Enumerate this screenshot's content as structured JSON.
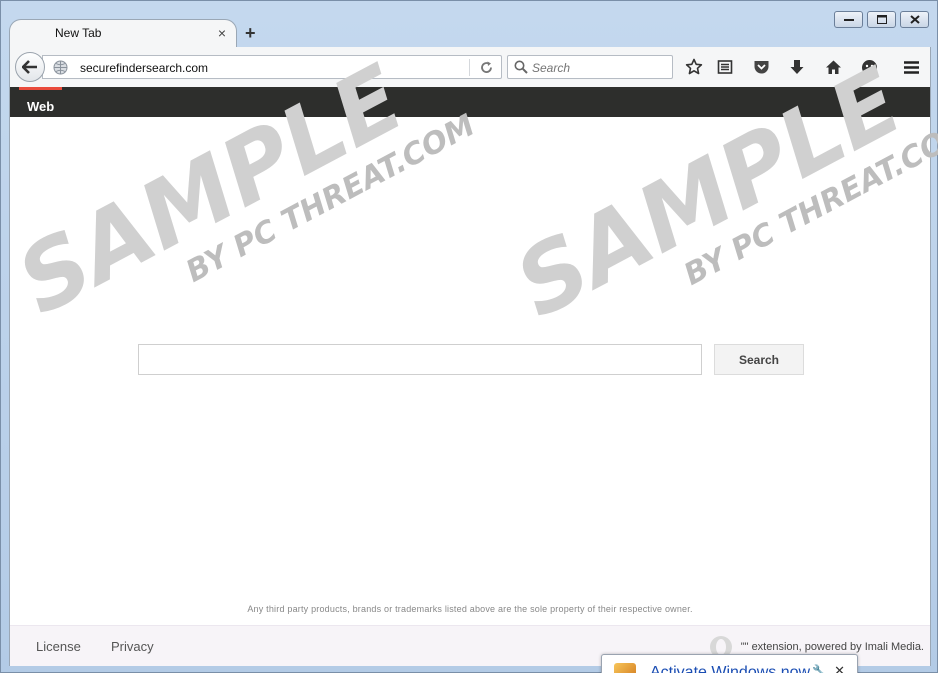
{
  "window": {
    "controls": [
      "minimize-icon",
      "restore-icon",
      "close-icon"
    ]
  },
  "tab": {
    "title": "New Tab",
    "close_glyph": "×",
    "new_tab_glyph": "+"
  },
  "toolbar": {
    "url": "securefindersearch.com",
    "search_placeholder": "Search",
    "icons": [
      "back-arrow-icon",
      "globe-icon",
      "reload-icon",
      "search-icon",
      "bookmark-star-icon",
      "reading-list-icon",
      "pocket-icon",
      "download-icon",
      "home-icon",
      "smiley-icon",
      "menu-icon"
    ]
  },
  "page": {
    "nav_tab": "Web",
    "search_button": "Search",
    "disclaimer": "Any third party products, brands or trademarks listed above are the sole property of their respective owner.",
    "footer": {
      "license": "License",
      "privacy": "Privacy",
      "powered_by": "\"\" extension, powered by Imali Media."
    }
  },
  "watermark": {
    "main": "SAMPLE",
    "sub": "BY PC THREAT.COM"
  },
  "popup": {
    "text": "Activate Windows now",
    "close_glyph": "✕",
    "tool_glyph": "🔧"
  },
  "colors": {
    "nav_bar": "#2d2e2c",
    "nav_accent": "#e94b3c",
    "window_frame": "#c4d8ee"
  }
}
